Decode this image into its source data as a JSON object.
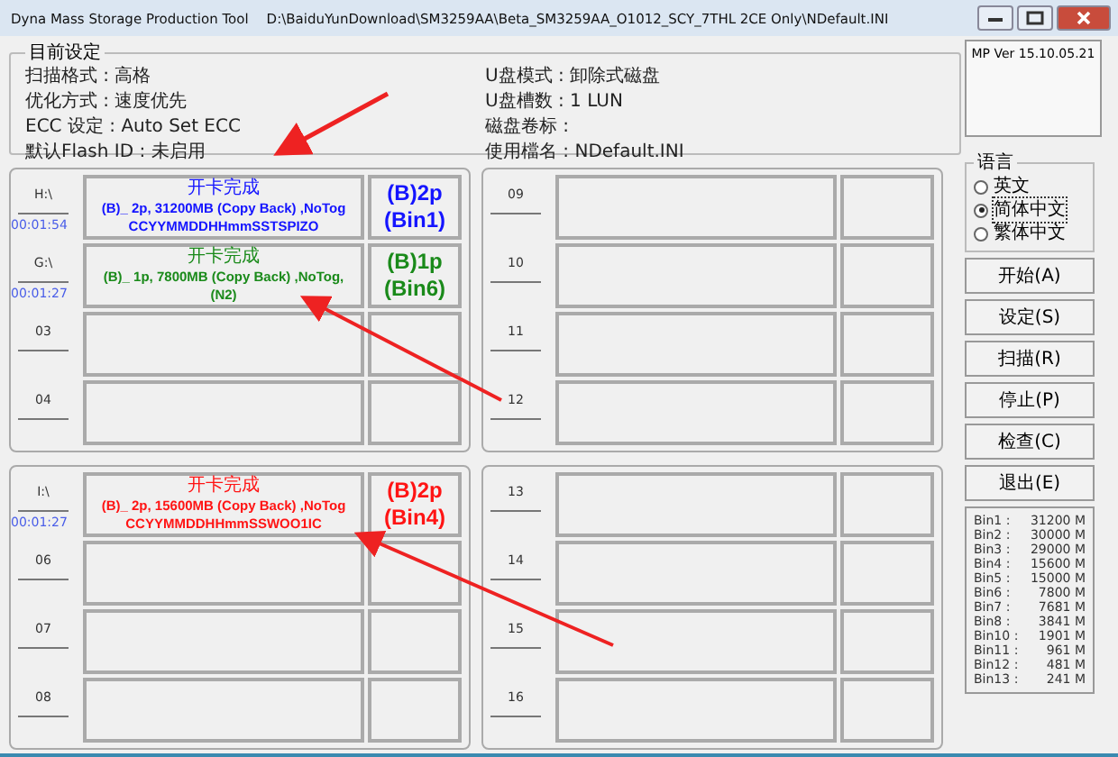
{
  "window": {
    "title": "Dyna Mass Storage Production Tool",
    "path": "D:\\BaiduYunDownload\\SM3259AA\\Beta_SM3259AA_O1012_SCY_7THL 2CE Only\\NDefault.INI"
  },
  "settings": {
    "title": "目前设定",
    "left": [
      "扫描格式 : 高格",
      "优化方式 : 速度优先",
      "ECC 设定 : Auto Set ECC",
      "默认Flash ID : 未启用"
    ],
    "right": [
      "U盘模式 : 卸除式磁盘",
      "U盘槽数 : 1 LUN",
      "磁盘卷标 :",
      "使用檔名 : NDefault.INI"
    ]
  },
  "port_groups": [
    {
      "slots": [
        {
          "kind": "done",
          "label": "H:\\",
          "timer": "00:01:54",
          "color": "#1414ff",
          "lines": [
            "开卡完成",
            "(B)_ 2p, 31200MB  (Copy Back) ,NoTog",
            "CCYYMMDDHHmmSSTSPIZO"
          ],
          "bin": [
            "(B)2p",
            "(Bin1)"
          ]
        },
        {
          "kind": "done",
          "label": "G:\\",
          "timer": "00:01:27",
          "color": "#1a8a1a",
          "lines": [
            "开卡完成",
            "(B)_ 1p,  7800MB  (Copy Back) ,NoTog,",
            "(N2)"
          ],
          "bin": [
            "(B)1p",
            "(Bin6)"
          ]
        },
        {
          "kind": "empty",
          "label": "03"
        },
        {
          "kind": "empty",
          "label": "04"
        }
      ]
    },
    {
      "slots": [
        {
          "kind": "empty",
          "label": "09"
        },
        {
          "kind": "empty",
          "label": "10"
        },
        {
          "kind": "empty",
          "label": "11"
        },
        {
          "kind": "empty",
          "label": "12"
        }
      ]
    },
    {
      "slots": [
        {
          "kind": "done",
          "label": "I:\\",
          "timer": "00:01:27",
          "color": "#ff1414",
          "lines": [
            "开卡完成",
            "(B)_ 2p, 15600MB  (Copy Back) ,NoTog",
            "CCYYMMDDHHmmSSWOO1IC"
          ],
          "bin": [
            "(B)2p",
            "(Bin4)"
          ]
        },
        {
          "kind": "empty",
          "label": "06"
        },
        {
          "kind": "empty",
          "label": "07"
        },
        {
          "kind": "empty",
          "label": "08"
        }
      ]
    },
    {
      "slots": [
        {
          "kind": "empty",
          "label": "13"
        },
        {
          "kind": "empty",
          "label": "14"
        },
        {
          "kind": "empty",
          "label": "15"
        },
        {
          "kind": "empty",
          "label": "16"
        }
      ]
    }
  ],
  "version": "MP Ver 15.10.05.21",
  "language": {
    "title": "语言",
    "options": [
      {
        "label": "英文",
        "selected": false
      },
      {
        "label": "简体中文",
        "selected": true
      },
      {
        "label": "繁体中文",
        "selected": false
      }
    ]
  },
  "buttons": [
    "开始(A)",
    "设定(S)",
    "扫描(R)",
    "停止(P)",
    "检查(C)",
    "退出(E)"
  ],
  "bins": [
    {
      "name": "Bin1 :",
      "size": "31200 M"
    },
    {
      "name": "Bin2 :",
      "size": "30000 M"
    },
    {
      "name": "Bin3 :",
      "size": "29000 M"
    },
    {
      "name": "Bin4 :",
      "size": "15600 M"
    },
    {
      "name": "Bin5 :",
      "size": "15000 M"
    },
    {
      "name": "Bin6 :",
      "size": "7800 M"
    },
    {
      "name": "Bin7 :",
      "size": "7681 M"
    },
    {
      "name": "Bin8 :",
      "size": "3841 M"
    },
    {
      "name": "Bin10 :",
      "size": "1901 M"
    },
    {
      "name": "Bin11 :",
      "size": "961 M"
    },
    {
      "name": "Bin12 :",
      "size": "481 M"
    },
    {
      "name": "Bin13 :",
      "size": "241 M"
    }
  ]
}
